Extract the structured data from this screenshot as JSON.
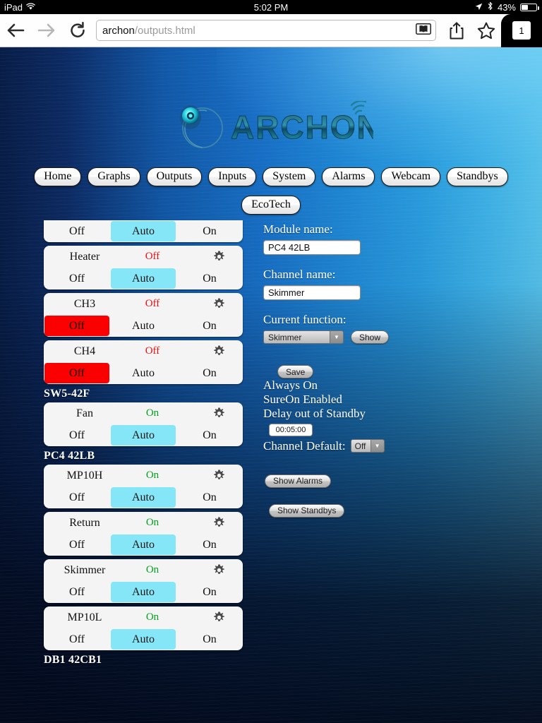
{
  "status_bar": {
    "device": "iPad",
    "wifi_icon": "wifi-icon",
    "time": "5:02 PM",
    "location_icon": "location-arrow-icon",
    "bluetooth_icon": "bluetooth-icon",
    "battery_percent": "43%",
    "battery_icon": "battery-icon"
  },
  "browser": {
    "back_icon": "back-arrow-icon",
    "forward_icon": "forward-arrow-icon",
    "reload_icon": "reload-icon",
    "url_bold": "archon",
    "url_dim": "/outputs.html",
    "reader_icon": "reader-view-icon",
    "share_icon": "share-icon",
    "bookmark_icon": "bookmark-star-icon",
    "tab_count": "1"
  },
  "logo": {
    "wordmark": "ARCHON",
    "mark_icon": "archon-swirl-icon",
    "signal_icon": "signal-arcs-icon"
  },
  "nav": {
    "row1": [
      {
        "label": "Home"
      },
      {
        "label": "Graphs"
      },
      {
        "label": "Outputs"
      },
      {
        "label": "Inputs"
      },
      {
        "label": "System"
      },
      {
        "label": "Alarms"
      },
      {
        "label": "Webcam"
      },
      {
        "label": "Standbys"
      }
    ],
    "row2": [
      {
        "label": "EcoTech"
      }
    ]
  },
  "outputs": {
    "mode_labels": {
      "off": "Off",
      "auto": "Auto",
      "on": "On"
    },
    "gear_icon": "gear-icon",
    "blocks": [
      {
        "group": null,
        "cards": [
          {
            "clipped": true,
            "name": "",
            "state": "",
            "state_kind": "",
            "selected": "auto"
          },
          {
            "clipped": false,
            "name": "Heater",
            "state": "Off",
            "state_kind": "off",
            "selected": "auto"
          },
          {
            "clipped": false,
            "name": "CH3",
            "state": "Off",
            "state_kind": "off",
            "selected": "off"
          },
          {
            "clipped": false,
            "name": "CH4",
            "state": "Off",
            "state_kind": "off",
            "selected": "off"
          }
        ]
      },
      {
        "group": "SW5-42F",
        "cards": [
          {
            "clipped": false,
            "name": "Fan",
            "state": "On",
            "state_kind": "on",
            "selected": "auto"
          }
        ]
      },
      {
        "group": "PC4 42LB",
        "cards": [
          {
            "clipped": false,
            "name": "MP10H",
            "state": "On",
            "state_kind": "on",
            "selected": "auto"
          },
          {
            "clipped": false,
            "name": "Return",
            "state": "On",
            "state_kind": "on",
            "selected": "auto"
          },
          {
            "clipped": false,
            "name": "Skimmer",
            "state": "On",
            "state_kind": "on",
            "selected": "auto"
          },
          {
            "clipped": false,
            "name": "MP10L",
            "state": "On",
            "state_kind": "on",
            "selected": "auto"
          }
        ]
      },
      {
        "group": "DB1 42CB1",
        "cards": []
      }
    ]
  },
  "detail": {
    "module_name_label": "Module name:",
    "module_name_value": "PC4 42LB",
    "channel_name_label": "Channel name:",
    "channel_name_value": "Skimmer",
    "current_function_label": "Current function:",
    "current_function_value": "Skimmer",
    "show_button": "Show",
    "save_button": "Save",
    "always_on": "Always On",
    "sure_on": "SureOn Enabled",
    "delay_label": "Delay out of Standby",
    "delay_value": "00:05:00",
    "channel_default_label": "Channel Default:",
    "channel_default_value": "Off",
    "show_alarms_button": "Show Alarms",
    "show_standbys_button": "Show Standbys"
  },
  "colors": {
    "auto_selected": "#85e6f7",
    "off_selected": "#fb0000",
    "state_on": "#00a21e",
    "state_off": "#e81010",
    "card_bg": "#f4f4f4"
  }
}
